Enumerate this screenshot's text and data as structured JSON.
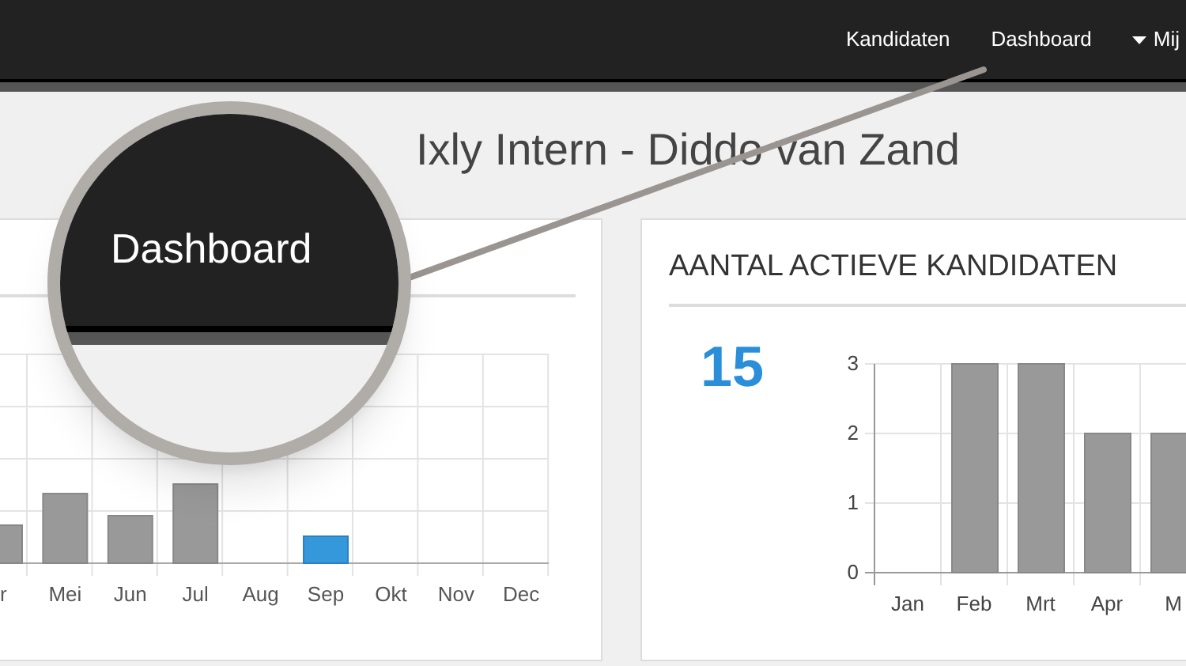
{
  "navbar": {
    "items": [
      {
        "label": "Kandidaten",
        "dropdown": false
      },
      {
        "label": "Dashboard",
        "dropdown": false
      },
      {
        "label": "Mij",
        "dropdown": true
      }
    ]
  },
  "page_title": "Ixly Intern - Diddo van Zand",
  "left_panel": {
    "x_labels": [
      {
        "label": "r",
        "highlighted": false
      },
      {
        "label": "Mei",
        "highlighted": false
      },
      {
        "label": "Jun",
        "highlighted": false
      },
      {
        "label": "Jul",
        "highlighted": false
      },
      {
        "label": "Aug",
        "highlighted": false
      },
      {
        "label": "Sep",
        "highlighted": true
      },
      {
        "label": "Okt",
        "highlighted": false
      },
      {
        "label": "Nov",
        "highlighted": false
      },
      {
        "label": "Dec",
        "highlighted": false
      }
    ]
  },
  "right_panel": {
    "title": "AANTAL ACTIEVE KANDIDATEN",
    "total": "15",
    "chart_data": {
      "type": "bar",
      "categories": [
        "Jan",
        "Feb",
        "Mrt",
        "Apr",
        "M"
      ],
      "series": [
        {
          "color": "#999999",
          "values": [
            0,
            3,
            3,
            2,
            2
          ]
        }
      ],
      "ylim": [
        0,
        3
      ],
      "yticks": [
        0,
        1,
        2,
        3
      ]
    }
  },
  "magnifier": {
    "label": "Dashboard"
  }
}
